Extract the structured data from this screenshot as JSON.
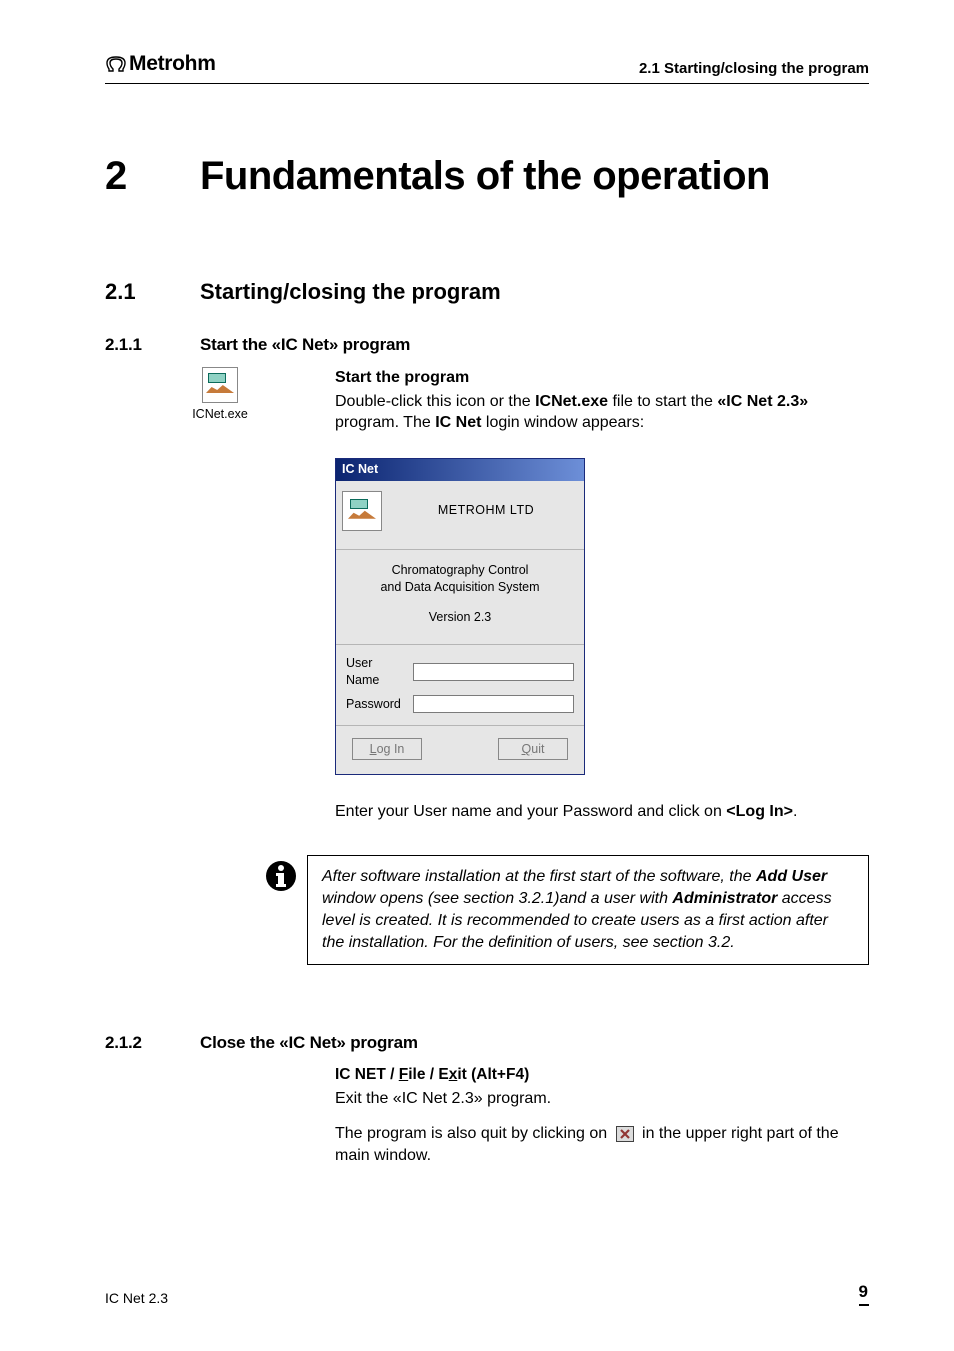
{
  "header": {
    "brand": "Metrohm",
    "section_ref": "2.1  Starting/closing the program"
  },
  "chapter": {
    "number": "2",
    "title": "Fundamentals of the operation"
  },
  "section_2_1": {
    "number": "2.1",
    "title": "Starting/closing the program"
  },
  "section_2_1_1": {
    "number": "2.1.1",
    "title": "Start the «IC Net» program",
    "icon_label": "ICNet.exe",
    "para_title": "Start the program",
    "para_pre": "Double-click this icon or the ",
    "exe": "ICNet.exe",
    "para_mid": " file to start the ",
    "prod": "«IC Net 2.3»",
    "para_post1": " program. The ",
    "icnet": "IC Net",
    "para_post2": " login window appears:",
    "after_login_pre": "Enter your User name and your Password and click on ",
    "after_login_btn": "<Log In>",
    "after_login_post": "."
  },
  "login": {
    "title": "IC Net",
    "company": "METROHM LTD",
    "desc1": "Chromatography Control",
    "desc2": "and Data Acquisition System",
    "version": "Version 2.3",
    "user_label": "User Name",
    "pass_label": "Password",
    "user_value": "",
    "pass_value": "",
    "login_L": "L",
    "login_rest": "og In",
    "quit_Q": "Q",
    "quit_rest": "uit"
  },
  "note": {
    "t1": "After software installation at the first start of the software, the ",
    "adduser": "Add User",
    "t2": " window opens (see section 3.2.1)and a user with ",
    "admin": "Administrator",
    "t3": " access level is created. It is recommended to create users as a first action after the installation. For the definition of users, see section 3.2."
  },
  "section_2_1_2": {
    "number": "2.1.2",
    "title": "Close the «IC Net» program",
    "menu_icnet": "IC NET",
    "sep": " / ",
    "file_F": "F",
    "file_rest": "ile",
    "exit_E": "E",
    "exit_x": "x",
    "exit_rest": "it",
    "shortcut": "  (Alt+F4)",
    "exit_line": "Exit the «IC Net 2.3» program.",
    "close_pre": "The program is also quit by clicking on",
    "close_post": "in the upper right part of the main window."
  },
  "footer": {
    "product": "IC Net 2.3",
    "page": "9"
  }
}
